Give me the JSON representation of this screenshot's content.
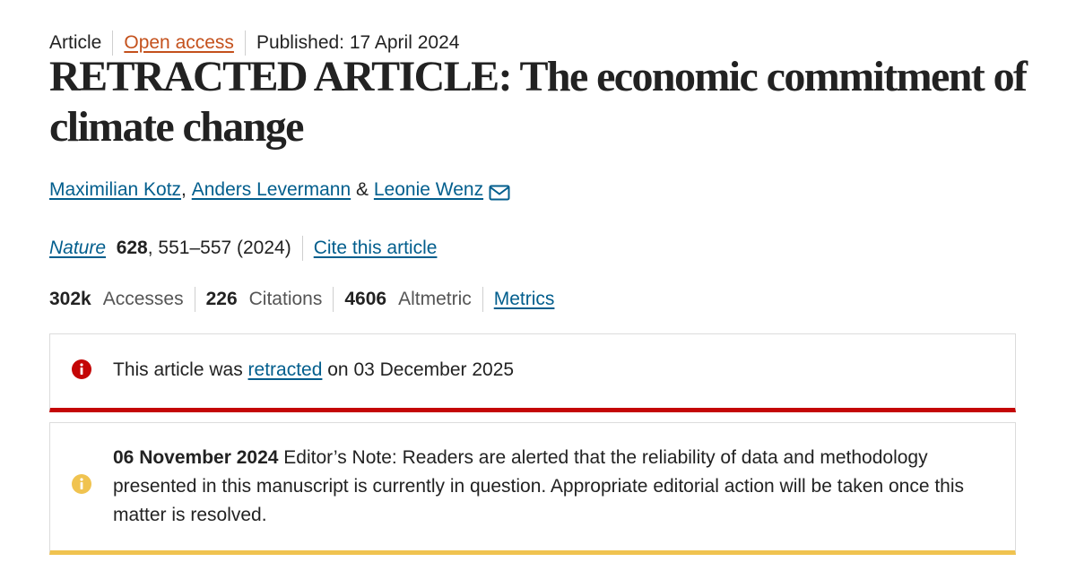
{
  "meta": {
    "article_type": "Article",
    "open_access": "Open access",
    "published": "Published: 17 April 2024"
  },
  "title": "RETRACTED ARTICLE: The economic commitment of climate change",
  "authors": {
    "list": [
      "Maximilian Kotz",
      "Anders Levermann",
      "Leonie Wenz"
    ],
    "separator_comma": ",",
    "separator_and": "&",
    "contact_icon": "mail-icon"
  },
  "citation": {
    "journal": "Nature",
    "volume": "628",
    "pages_year": ", 551–557 (2024)",
    "cite_link": "Cite this article"
  },
  "metrics": {
    "accesses_value": "302k",
    "accesses_label": "Accesses",
    "citations_value": "226",
    "citations_label": "Citations",
    "altmetric_value": "4606",
    "altmetric_label": "Altmetric",
    "metrics_link": "Metrics"
  },
  "retraction_notice": {
    "icon": "error-info-icon",
    "text_before": "This article was ",
    "link": "retracted",
    "text_after": " on 03 December 2025",
    "accent_color": "#c40606"
  },
  "editor_note": {
    "icon": "warning-info-icon",
    "date": "06 November 2024",
    "text": " Editor’s Note: Readers are alerted that the reliability of data and methodology presented in this manuscript is currently in question. Appropriate editorial action will be taken once this matter is resolved.",
    "accent_color": "#f0c350"
  },
  "colors": {
    "link": "#025e8d",
    "open_access": "#c4511c",
    "text": "#222222"
  }
}
